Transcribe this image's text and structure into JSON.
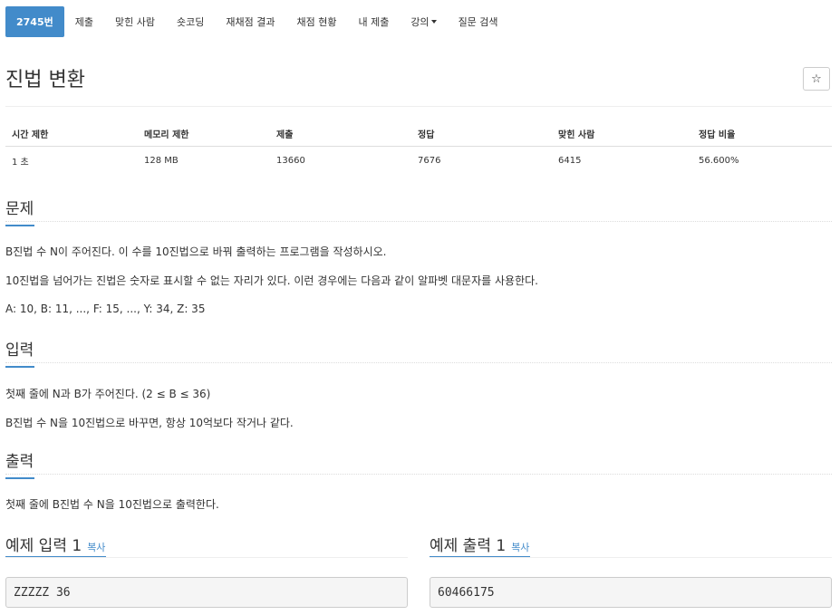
{
  "tabs": [
    {
      "label": "2745번",
      "active": true
    },
    {
      "label": "제출"
    },
    {
      "label": "맞힌 사람"
    },
    {
      "label": "숏코딩"
    },
    {
      "label": "재채점 결과"
    },
    {
      "label": "채점 현황"
    },
    {
      "label": "내 제출"
    },
    {
      "label": "강의"
    },
    {
      "label": "질문 검색"
    }
  ],
  "problem": {
    "title": "진법 변환",
    "star_glyph": "☆"
  },
  "info": {
    "headers": [
      "시간 제한",
      "메모리 제한",
      "제출",
      "정답",
      "맞힌 사람",
      "정답 비율"
    ],
    "values": [
      "1 초",
      "128 MB",
      "13660",
      "7676",
      "6415",
      "56.600%"
    ]
  },
  "sections": {
    "description": {
      "heading": "문제",
      "lines": [
        "B진법 수 N이 주어진다. 이 수를 10진법으로 바꿔 출력하는 프로그램을 작성하시오.",
        "10진법을 넘어가는 진법은 숫자로 표시할 수 없는 자리가 있다. 이런 경우에는 다음과 같이 알파벳 대문자를 사용한다.",
        "A: 10, B: 11, ..., F: 15, ..., Y: 34, Z: 35"
      ]
    },
    "input": {
      "heading": "입력",
      "lines": [
        "첫째 줄에 N과 B가 주어진다. (2 ≤ B ≤ 36)",
        "B진법 수 N을 10진법으로 바꾸면, 항상 10억보다 작거나 같다."
      ]
    },
    "output": {
      "heading": "출력",
      "lines": [
        "첫째 줄에 B진법 수 N을 10진법으로 출력한다."
      ]
    }
  },
  "samples": {
    "input": {
      "heading": "예제 입력 1",
      "copy_label": "복사",
      "content": "ZZZZZ 36"
    },
    "output": {
      "heading": "예제 출력 1",
      "copy_label": "복사",
      "content": "60466175"
    }
  },
  "colors": {
    "accent": "#428bca"
  }
}
